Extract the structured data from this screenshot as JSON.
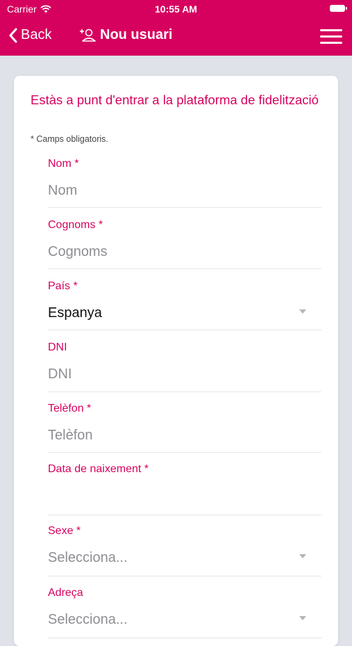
{
  "status_bar": {
    "carrier": "Carrier",
    "time": "10:55 AM"
  },
  "nav": {
    "back_label": "Back",
    "title": "Nou usuari"
  },
  "form": {
    "intro": "Estàs a punt d'entrar a la plataforma de fidelització",
    "required_note": "* Camps obligatoris.",
    "fields": [
      {
        "label": "Nom *",
        "placeholder": "Nom",
        "value": ""
      },
      {
        "label": "Cognoms *",
        "placeholder": "Cognoms",
        "value": ""
      },
      {
        "label": "País *",
        "value": "Espanya"
      },
      {
        "label": "DNI",
        "placeholder": "DNI",
        "value": ""
      },
      {
        "label": "Telèfon *",
        "placeholder": "Telèfon",
        "value": ""
      },
      {
        "label": "Data de naixement *",
        "value": ""
      },
      {
        "label": "Sexe *",
        "placeholder": "Selecciona...",
        "value": ""
      },
      {
        "label": "Adreça",
        "placeholder": "Selecciona...",
        "value": ""
      }
    ]
  },
  "colors": {
    "brand": "#d6005e",
    "background": "#dfe2e8",
    "card": "#ffffff"
  }
}
